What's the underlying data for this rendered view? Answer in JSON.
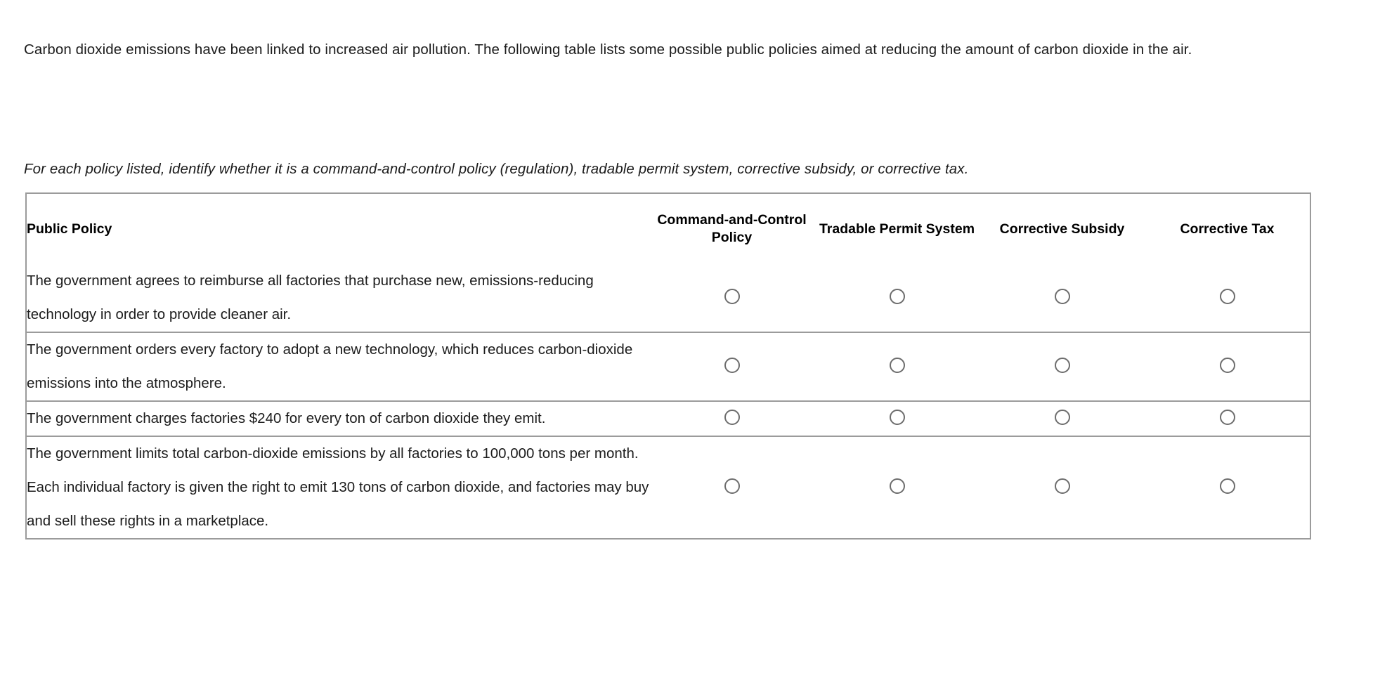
{
  "intro": {
    "paragraph": "Carbon dioxide emissions have been linked to increased air pollution. The following table lists some possible public policies aimed at reducing the amount of carbon dioxide in the air.",
    "instruction": "For each policy listed, identify whether it is a command-and-control policy (regulation), tradable permit system, corrective subsidy, or corrective tax."
  },
  "table": {
    "headers": {
      "policy": "Public Policy",
      "col1": "Command-and-Control Policy",
      "col2": "Tradable Permit System",
      "col3": "Corrective Subsidy",
      "col4": "Corrective Tax"
    },
    "rows": [
      {
        "text": "The government agrees to reimburse all factories that purchase new, emissions-reducing technology in order to provide cleaner air.",
        "selected": null
      },
      {
        "text": "The government orders every factory to adopt a new technology, which reduces carbon-dioxide emissions into the atmosphere.",
        "selected": null
      },
      {
        "text": "The government charges factories $240 for every ton of carbon dioxide they emit.",
        "selected": null
      },
      {
        "text": "The government limits total carbon-dioxide emissions by all factories to 100,000 tons per month. Each individual factory is given the right to emit 130 tons of carbon dioxide, and factories may buy and sell these rights in a marketplace.",
        "selected": null
      }
    ]
  },
  "colors": {
    "border": "#9b9b9b",
    "radio_stroke": "#6d6d6d",
    "text": "#1c1c1c",
    "background": "#ffffff"
  }
}
